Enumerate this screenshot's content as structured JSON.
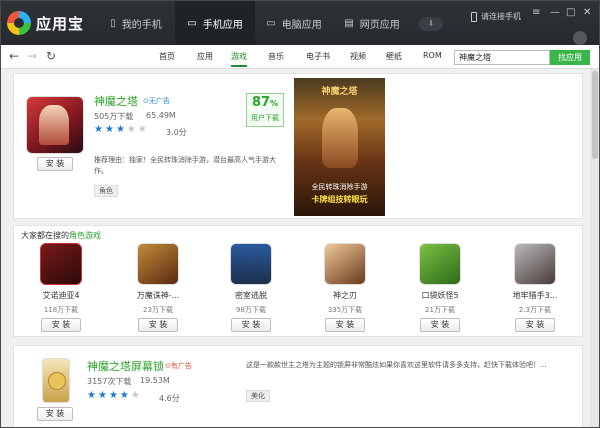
{
  "app": {
    "name": "应用宝"
  },
  "top_tabs": [
    {
      "label": "我的手机",
      "icon": "phone-icon"
    },
    {
      "label": "手机应用",
      "icon": "tablet-icon",
      "active": true
    },
    {
      "label": "电脑应用",
      "icon": "monitor-icon"
    },
    {
      "label": "网页应用",
      "icon": "webpage-icon"
    }
  ],
  "connect_label": "请连接手机",
  "window_controls": [
    "≡",
    "—",
    "□",
    "✕"
  ],
  "nav": {
    "items": [
      "首页",
      "应用",
      "游戏",
      "音乐",
      "电子书",
      "视频",
      "壁纸",
      "ROM"
    ],
    "active": "游戏",
    "search_value": "神魔之塔",
    "search_button": "找应用"
  },
  "featured": {
    "title": "神魔之塔",
    "ad_label": "无广告",
    "downloads": "505万下载",
    "size": "65.49M",
    "rating": 3.0,
    "rating_text": "3.0分",
    "reason": "推荐理由：独家！全民转珠消除手游，潜台最高人气手游大作。",
    "tag": "角色",
    "install": "安 装",
    "favor_pct": "87",
    "favor_unit": "%",
    "favor_label": "用户下载",
    "banner_title": "神魔之塔",
    "banner_caption1": "全民转珠消除手游",
    "banner_caption2": "卡牌组技转眼玩"
  },
  "related": {
    "heading_prefix": "大家都在搜的",
    "heading_highlight": "角色游戏",
    "apps": [
      {
        "name": "艾诺迪亚4",
        "downloads": "118万下载",
        "install": "安 装"
      },
      {
        "name": "万魔诛神-...",
        "downloads": "23万下载",
        "install": "安 装"
      },
      {
        "name": "密室逃脱",
        "downloads": "98万下载",
        "install": "安 装"
      },
      {
        "name": "神之刃",
        "downloads": "335万下载",
        "install": "安 装"
      },
      {
        "name": "口袋妖怪5",
        "downloads": "21万下载",
        "install": "安 装"
      },
      {
        "name": "地牢猎手3...",
        "downloads": "2.3万下载",
        "install": "安 装"
      }
    ]
  },
  "bottom_app": {
    "title": "神魔之塔屏幕锁",
    "ad_label": "有广告",
    "downloads": "3157次下载",
    "size": "19.53M",
    "rating": 4.6,
    "rating_text": "4.6分",
    "desc": "这是一款款世主之塔为主题的锁屏非常酷炫如果你喜欢这里软件请多多支持，赶快下载体验吧！...",
    "tag": "美化",
    "install": "安 装"
  }
}
